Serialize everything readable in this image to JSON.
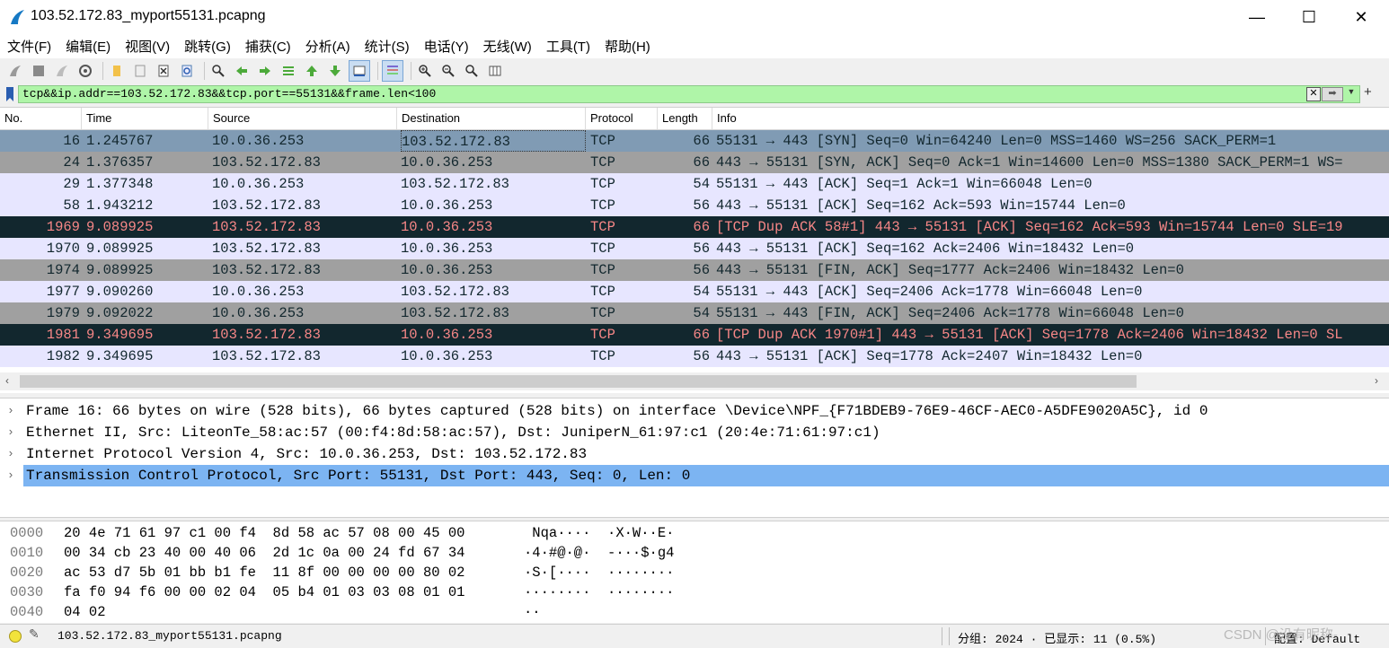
{
  "window": {
    "title": "103.52.172.83_myport55131.pcapng",
    "minimize": "—",
    "maximize": "☐",
    "close": "✕"
  },
  "menu": [
    "文件(F)",
    "编辑(E)",
    "视图(V)",
    "跳转(G)",
    "捕获(C)",
    "分析(A)",
    "统计(S)",
    "电话(Y)",
    "无线(W)",
    "工具(T)",
    "帮助(H)"
  ],
  "toolbar_icons": [
    "start-capture-icon",
    "stop-capture-icon",
    "restart-capture-icon",
    "capture-options-icon",
    "open-file-icon",
    "save-file-icon",
    "close-file-icon",
    "reload-file-icon",
    "find-packet-icon",
    "go-back-icon",
    "go-forward-icon",
    "go-to-packet-icon",
    "first-packet-icon",
    "last-packet-icon",
    "autoscroll-icon",
    "colorize-icon",
    "zoom-in-icon",
    "zoom-out-icon",
    "normal-size-icon",
    "resize-columns-icon"
  ],
  "filter": {
    "value": "tcp&&ip.addr==103.52.172.83&&tcp.port==55131&&frame.len<100"
  },
  "packet_list": {
    "columns": [
      "No.",
      "Time",
      "Source",
      "Destination",
      "Protocol",
      "Length",
      "Info"
    ],
    "rows": [
      {
        "no": "16",
        "time": "1.245767",
        "src": "10.0.36.253",
        "dst": "103.52.172.83",
        "proto": "TCP",
        "len": "66",
        "info": "55131 → 443 [SYN] Seq=0 Win=64240 Len=0 MSS=1460 WS=256 SACK_PERM=1",
        "style": "sel"
      },
      {
        "no": "24",
        "time": "1.376357",
        "src": "103.52.172.83",
        "dst": "10.0.36.253",
        "proto": "TCP",
        "len": "66",
        "info": "443 → 55131 [SYN, ACK] Seq=0 Ack=1 Win=14600 Len=0 MSS=1380 SACK_PERM=1 WS=",
        "style": "syn"
      },
      {
        "no": "29",
        "time": "1.377348",
        "src": "10.0.36.253",
        "dst": "103.52.172.83",
        "proto": "TCP",
        "len": "54",
        "info": "55131 → 443 [ACK] Seq=1 Ack=1 Win=66048 Len=0",
        "style": "tcp"
      },
      {
        "no": "58",
        "time": "1.943212",
        "src": "103.52.172.83",
        "dst": "10.0.36.253",
        "proto": "TCP",
        "len": "56",
        "info": "443 → 55131 [ACK] Seq=162 Ack=593 Win=15744 Len=0",
        "style": "tcp"
      },
      {
        "no": "1969",
        "time": "9.089925",
        "src": "103.52.172.83",
        "dst": "10.0.36.253",
        "proto": "TCP",
        "len": "66",
        "info": "[TCP Dup ACK 58#1] 443 → 55131 [ACK] Seq=162 Ack=593 Win=15744 Len=0 SLE=19",
        "style": "bad"
      },
      {
        "no": "1970",
        "time": "9.089925",
        "src": "103.52.172.83",
        "dst": "10.0.36.253",
        "proto": "TCP",
        "len": "56",
        "info": "443 → 55131 [ACK] Seq=162 Ack=2406 Win=18432 Len=0",
        "style": "tcp"
      },
      {
        "no": "1974",
        "time": "9.089925",
        "src": "103.52.172.83",
        "dst": "10.0.36.253",
        "proto": "TCP",
        "len": "56",
        "info": "443 → 55131 [FIN, ACK] Seq=1777 Ack=2406 Win=18432 Len=0",
        "style": "syn"
      },
      {
        "no": "1977",
        "time": "9.090260",
        "src": "10.0.36.253",
        "dst": "103.52.172.83",
        "proto": "TCP",
        "len": "54",
        "info": "55131 → 443 [ACK] Seq=2406 Ack=1778 Win=66048 Len=0",
        "style": "tcp"
      },
      {
        "no": "1979",
        "time": "9.092022",
        "src": "10.0.36.253",
        "dst": "103.52.172.83",
        "proto": "TCP",
        "len": "54",
        "info": "55131 → 443 [FIN, ACK] Seq=2406 Ack=1778 Win=66048 Len=0",
        "style": "syn"
      },
      {
        "no": "1981",
        "time": "9.349695",
        "src": "103.52.172.83",
        "dst": "10.0.36.253",
        "proto": "TCP",
        "len": "66",
        "info": "[TCP Dup ACK 1970#1] 443 → 55131 [ACK] Seq=1778 Ack=2406 Win=18432 Len=0 SL",
        "style": "bad"
      },
      {
        "no": "1982",
        "time": "9.349695",
        "src": "103.52.172.83",
        "dst": "10.0.36.253",
        "proto": "TCP",
        "len": "56",
        "info": "443 → 55131 [ACK] Seq=1778 Ack=2407 Win=18432 Len=0",
        "style": "tcp"
      }
    ]
  },
  "details": [
    {
      "text": "Frame 16: 66 bytes on wire (528 bits), 66 bytes captured (528 bits) on interface \\Device\\NPF_{F71BDEB9-76E9-46CF-AEC0-A5DFE9020A5C}, id 0",
      "selected": false
    },
    {
      "text": "Ethernet II, Src: LiteonTe_58:ac:57 (00:f4:8d:58:ac:57), Dst: JuniperN_61:97:c1 (20:4e:71:61:97:c1)",
      "selected": false
    },
    {
      "text": "Internet Protocol Version 4, Src: 10.0.36.253, Dst: 103.52.172.83",
      "selected": false
    },
    {
      "text": "Transmission Control Protocol, Src Port: 55131, Dst Port: 443, Seq: 0, Len: 0",
      "selected": true
    }
  ],
  "bytes": [
    {
      "offset": "0000",
      "hex": "20 4e 71 61 97 c1 00 f4  8d 58 ac 57 08 00 45 00",
      "ascii": " Nqa····  ·X·W··E·"
    },
    {
      "offset": "0010",
      "hex": "00 34 cb 23 40 00 40 06  2d 1c 0a 00 24 fd 67 34",
      "ascii": "·4·#@·@·  -···$·g4"
    },
    {
      "offset": "0020",
      "hex": "ac 53 d7 5b 01 bb b1 fe  11 8f 00 00 00 00 80 02",
      "ascii": "·S·[····  ········"
    },
    {
      "offset": "0030",
      "hex": "fa f0 94 f6 00 00 02 04  05 b4 01 03 03 08 01 01",
      "ascii": "········  ········"
    },
    {
      "offset": "0040",
      "hex": "04 02",
      "ascii": "··"
    }
  ],
  "status": {
    "file": "103.52.172.83_myport55131.pcapng",
    "packets": "分组: 2024 · 已显示: 11 (0.5%)",
    "profile": "配置: Default",
    "watermark": "CSDN @没有昵称-"
  }
}
